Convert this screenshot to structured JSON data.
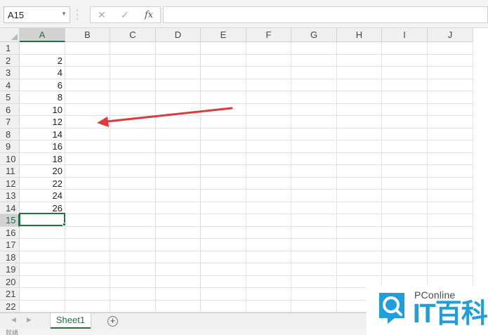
{
  "formula_bar": {
    "name_box": "A15",
    "cancel_glyph": "✕",
    "enter_glyph": "✓",
    "fx_label": "fx",
    "formula": ""
  },
  "columns": [
    "A",
    "B",
    "C",
    "D",
    "E",
    "F",
    "G",
    "H",
    "I",
    "J"
  ],
  "rows": [
    "1",
    "2",
    "3",
    "4",
    "5",
    "6",
    "7",
    "8",
    "9",
    "10",
    "11",
    "12",
    "13",
    "14",
    "15",
    "16",
    "17",
    "18",
    "19",
    "20",
    "21",
    "22"
  ],
  "cells_A": [
    "",
    "2",
    "4",
    "6",
    "8",
    "10",
    "12",
    "14",
    "16",
    "18",
    "20",
    "22",
    "24",
    "26",
    "",
    "",
    "",
    "",
    "",
    "",
    "",
    ""
  ],
  "selection": {
    "cell": "A15",
    "column": "A",
    "row": "15"
  },
  "annotation": {
    "type": "arrow",
    "color": "#e0393b"
  },
  "sheets": [
    {
      "label": "Sheet1",
      "active": true
    }
  ],
  "add_sheet_glyph": "+",
  "status": {
    "text": "就绪"
  },
  "watermark": {
    "small": "PConline",
    "big": "IT百科",
    "color": "#1e9fdc"
  },
  "colors": {
    "accent": "#217346",
    "grid": "#e1e1e1",
    "header": "#f0f0f0"
  }
}
